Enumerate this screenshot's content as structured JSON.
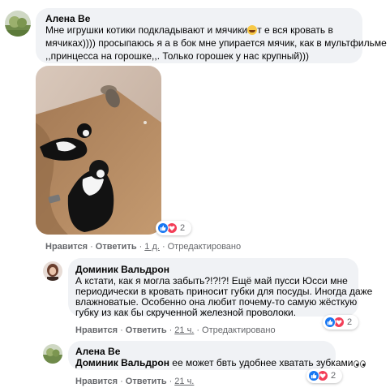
{
  "comments": [
    {
      "author": "Алена Ве",
      "lines": [
        "Мне игрушки котики подкладывают и мячики",
        "т е вся кровать в",
        "мячиках)))) просыпаюсь я а в бок мне упирается мячик, как в мультфильме",
        ",,принцесса на горошке,,. Только горошек у нас крупный)))"
      ],
      "emoji": "rofl-emoji",
      "reactions": {
        "icons": [
          "like-icon",
          "love-icon"
        ],
        "count": "2"
      },
      "actions": {
        "like": "Нравится",
        "reply": "Ответить",
        "time": "1 д.",
        "edited": "Отредактировано"
      }
    },
    {
      "author": "Доминик Вальдрон",
      "lines": [
        "А кстати, как я могла забыть?!?!?! Ещё май пусси Юсси мне",
        "периодически в кровать приносит губки для посуды. Иногда даже",
        "влажноватые. Особенно она любит почему-то самую жёсткую",
        "губку из как бы скрученной железной проволоки."
      ],
      "reactions": {
        "icons": [
          "like-icon",
          "love-icon"
        ],
        "count": "2"
      },
      "actions": {
        "like": "Нравится",
        "reply": "Ответить",
        "time": "21 ч.",
        "edited": "Отредактировано"
      }
    },
    {
      "author": "Алена Ве",
      "mention": "Доминик Вальдрон",
      "text": "ее может бвть удобнее хватать зубками",
      "emoji": "eyes-emoji",
      "reactions": {
        "icons": [
          "like-icon",
          "love-icon"
        ],
        "count": "2"
      },
      "actions": {
        "like": "Нравится",
        "reply": "Ответить",
        "time": "21 ч."
      }
    }
  ],
  "separator": "·",
  "colors": {
    "bubble": "#f0f2f5",
    "meta": "#65676b",
    "like": "#1877f2",
    "love": "#f33e58"
  }
}
